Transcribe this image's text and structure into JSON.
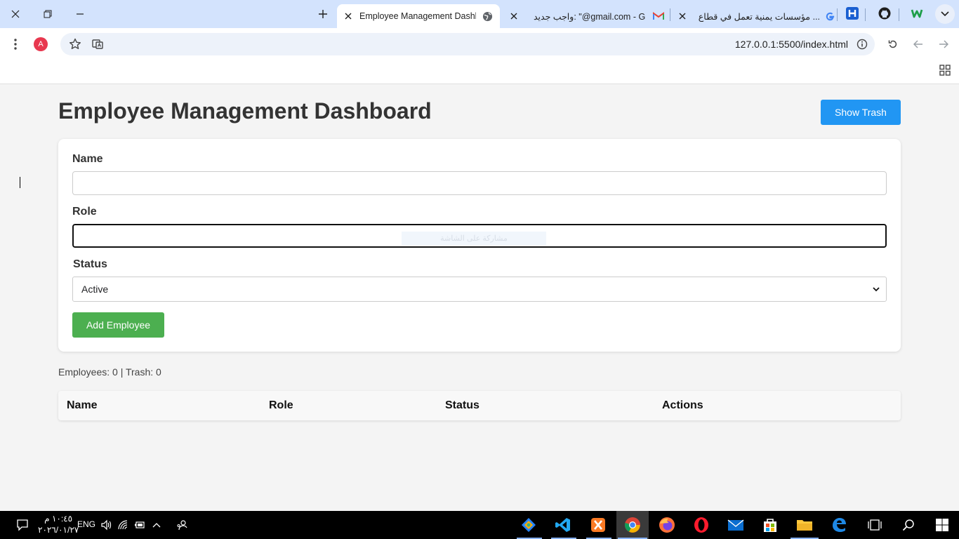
{
  "browser": {
    "tabs": [
      {
        "title": "Employee Management Dashboard",
        "active": true
      },
      {
        "title": "واجب جديد: \"@gmail.com - Gmail",
        "active": false
      },
      {
        "title": "مؤسسات يمنية تعمل في قطاع ...",
        "active": false
      }
    ],
    "pinned": [
      "H",
      "github",
      "w"
    ],
    "url": "127.0.0.1:5500/index.html",
    "avatar_letter": "A"
  },
  "page": {
    "title": "Employee Management Dashboard",
    "show_trash_label": "Show Trash",
    "form": {
      "name_label": "Name",
      "name_value": "",
      "role_label": "Role",
      "role_value": "",
      "status_label": "Status",
      "status_selected": "Active",
      "add_label": "Add Employee"
    },
    "overlay_hint": "مشاركة على الشاشة",
    "counts": "Employees: 0 | Trash: 0",
    "table": {
      "headers": [
        "Name",
        "Role",
        "Status",
        "Actions"
      ]
    }
  },
  "colors": {
    "primary": "#2196f3",
    "success": "#4caf50",
    "background": "#f4f4f4"
  },
  "taskbar": {
    "time": "١٠:٤٥ م",
    "date": "٢٠٢٦/٠١/٢٧",
    "language": "ENG",
    "apps": [
      "sourcetree",
      "vscode",
      "xampp",
      "chrome",
      "firefox",
      "opera",
      "mail",
      "store",
      "file-explorer",
      "edge"
    ]
  }
}
